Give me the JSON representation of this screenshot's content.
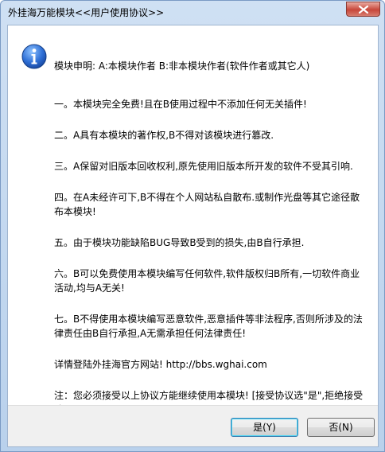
{
  "window": {
    "title": "外挂海万能模块<<用户使用协议>>"
  },
  "icons": {
    "close": "close-icon",
    "info": "info-icon"
  },
  "message": {
    "header": "模块申明:  A:本模块作者  B:非本模块作者(软件作者或其它人)",
    "items": [
      "一。本模块完全免费!且在B使用过程中不添加任何无关插件!",
      "二。A具有本模块的著作权,B不得对该模块进行篡改.",
      "三。A保留对旧版本回收权利,原先使用旧版本所开发的软件不受其引响.",
      "四。在A未经许可下,B不得在个人网站私自散布.或制作光盘等其它途径散布本模块!",
      "五。由于模块功能缺陷BUG导致B受到的损失,由B自行承担.",
      "六。B可以免费使用本模块编写任何软件,软件版权归B所有,一切软件商业活动,均与A无关!",
      "七。B不得使用本模块编写恶意软件,恶意插件等非法程序,否则所涉及的法律责任由B自行承担,A无需承担任何法律责任!",
      "详情登陆外挂海官方网站! http://bbs.wghai.com",
      "注：您必须接受以上协议方能继续使用本模块! [接受协议选\"是\",拒绝接受选\"否\"]"
    ]
  },
  "buttons": {
    "yes": "是(Y)",
    "no": "否(N)"
  }
}
